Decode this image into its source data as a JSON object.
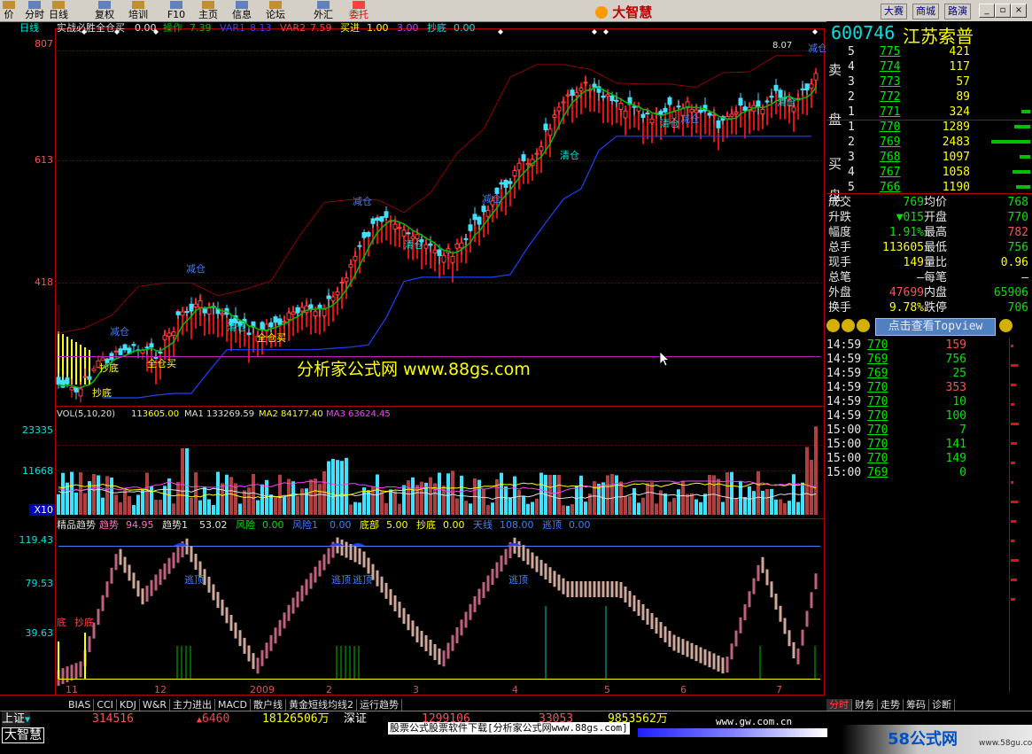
{
  "toolbar": {
    "items": [
      "价",
      "分时",
      "日线",
      "复权",
      "培训",
      "F10",
      "主页",
      "信息",
      "论坛",
      "外汇",
      "委托"
    ],
    "brand": "大智慧",
    "links": [
      "大赛",
      "商城",
      "路演"
    ]
  },
  "chart": {
    "period_label": "日线",
    "main_indicator": {
      "name": "实战必胜全仓买",
      "v": "0.00",
      "items": [
        {
          "t": "操作",
          "c": "#00c000"
        },
        {
          "t": "7.39",
          "c": "#00c000"
        },
        {
          "t": "VAR1",
          "c": "#4040ff"
        },
        {
          "t": "8.13",
          "c": "#4040ff"
        },
        {
          "t": "VAR2",
          "c": "#ff4040"
        },
        {
          "t": "7.59",
          "c": "#ff4040"
        },
        {
          "t": "买进",
          "c": "#ffff00"
        },
        {
          "t": "1.00",
          "c": "#ffff00"
        },
        {
          "t": "3.00",
          "c": "#c040ff"
        },
        {
          "t": "抄底",
          "c": "#00e0e0"
        },
        {
          "t": "0.00",
          "c": "#00e0e0"
        }
      ]
    },
    "y_main": [
      "807",
      "613",
      "418"
    ],
    "price_marker": "8.07",
    "watermark": "分析家公式网 www.88gs.com",
    "signals": [
      "减仓",
      "清仓",
      "减仓",
      "全仓买",
      "抄底",
      "全仓买",
      "减仓",
      "清仓",
      "减仓",
      "清仓",
      "减仓",
      "清仓",
      "清仓",
      "减仓",
      "抄底"
    ],
    "vol_indicator": {
      "label": "VOL(5,10,20)",
      "v": "113605.00",
      "ma1": "MA1 133269.59",
      "ma2": "MA2 84177.40",
      "ma3": "MA3 63624.45"
    },
    "y_vol": [
      "23335",
      "11668",
      "X10"
    ],
    "trend_indicator": {
      "name": "精品趋势",
      "items": [
        {
          "t": "趋势",
          "c": "#ff70c0"
        },
        {
          "t": "94.95",
          "c": "#ff70c0"
        },
        {
          "t": "趋势1",
          "c": "#e0e0e0"
        },
        {
          "t": "53.02",
          "c": "#e0e0e0"
        },
        {
          "t": "风险",
          "c": "#00e000"
        },
        {
          "t": "0.00",
          "c": "#00e000"
        },
        {
          "t": "风险1",
          "c": "#4080ff"
        },
        {
          "t": "0.00",
          "c": "#4080ff"
        },
        {
          "t": "底部",
          "c": "#ffff00"
        },
        {
          "t": "5.00",
          "c": "#ffff00"
        },
        {
          "t": "抄底",
          "c": "#ffff00"
        },
        {
          "t": "0.00",
          "c": "#ffff00"
        },
        {
          "t": "天线",
          "c": "#4080ff"
        },
        {
          "t": "108.00",
          "c": "#4080ff"
        },
        {
          "t": "逃顶",
          "c": "#4080ff"
        },
        {
          "t": "0.00",
          "c": "#4080ff"
        }
      ]
    },
    "y_trend": [
      "119.43",
      "79.53",
      "39.63"
    ],
    "trend_signals": [
      "逃顶",
      "逃顶",
      "逃顶",
      "逃顶"
    ],
    "trend_low_labels": [
      "底",
      "抄底"
    ],
    "x_labels": [
      "11",
      "12",
      "2009",
      "2",
      "3",
      "4",
      "5",
      "6",
      "7"
    ],
    "tabs": [
      "BIAS",
      "CCI",
      "KDJ",
      "W&R",
      "主力进出",
      "MACD",
      "散户线",
      "黄金短线均线2",
      "运行趋势"
    ]
  },
  "quote": {
    "code": "600746",
    "name": "江苏索普",
    "sell_label": [
      "卖",
      "盘"
    ],
    "buy_label": [
      "买",
      "盘"
    ],
    "sell": [
      {
        "lv": "5",
        "p": "775",
        "v": "421"
      },
      {
        "lv": "4",
        "p": "774",
        "v": "117"
      },
      {
        "lv": "3",
        "p": "773",
        "v": "57"
      },
      {
        "lv": "2",
        "p": "772",
        "v": "89"
      },
      {
        "lv": "1",
        "p": "771",
        "v": "324"
      }
    ],
    "buy": [
      {
        "lv": "1",
        "p": "770",
        "v": "1289"
      },
      {
        "lv": "2",
        "p": "769",
        "v": "2483"
      },
      {
        "lv": "3",
        "p": "768",
        "v": "1097"
      },
      {
        "lv": "4",
        "p": "767",
        "v": "1058"
      },
      {
        "lv": "5",
        "p": "766",
        "v": "1190"
      }
    ],
    "stats": [
      {
        "k1": "成交",
        "v1": "769",
        "c1": "green",
        "k2": "均价",
        "v2": "768",
        "c2": "green"
      },
      {
        "k1": "升跌",
        "v1": "▼015",
        "c1": "green",
        "k2": "开盘",
        "v2": "770",
        "c2": "green"
      },
      {
        "k1": "幅度",
        "v1": "1.91%",
        "c1": "green",
        "k2": "最高",
        "v2": "782",
        "c2": "red"
      },
      {
        "k1": "总手",
        "v1": "113605",
        "c1": "yellow",
        "k2": "最低",
        "v2": "756",
        "c2": "green"
      },
      {
        "k1": "现手",
        "v1": "149",
        "c1": "yellow",
        "k2": "量比",
        "v2": "0.96",
        "c2": "yellow"
      },
      {
        "k1": "总笔",
        "v1": "—",
        "c1": "white",
        "k2": "每笔",
        "v2": "—",
        "c2": "white"
      },
      {
        "k1": "外盘",
        "v1": "47699",
        "c1": "red",
        "k2": "内盘",
        "v2": "65906",
        "c2": "green"
      },
      {
        "k1": "换手",
        "v1": "9.78%",
        "c1": "yellow",
        "k2": "跌停",
        "v2": "706",
        "c2": "green"
      }
    ],
    "topview": "点击查看Topview",
    "ticks": [
      {
        "t": "14:59",
        "p": "770",
        "v": "159",
        "vc": "red"
      },
      {
        "t": "14:59",
        "p": "769",
        "v": "756",
        "vc": "green"
      },
      {
        "t": "14:59",
        "p": "769",
        "v": "25",
        "vc": "green"
      },
      {
        "t": "14:59",
        "p": "770",
        "v": "353",
        "vc": "red"
      },
      {
        "t": "14:59",
        "p": "770",
        "v": "10",
        "vc": "green"
      },
      {
        "t": "14:59",
        "p": "770",
        "v": "100",
        "vc": "green"
      },
      {
        "t": "15:00",
        "p": "770",
        "v": "7",
        "vc": "green"
      },
      {
        "t": "15:00",
        "p": "770",
        "v": "141",
        "vc": "green"
      },
      {
        "t": "15:00",
        "p": "770",
        "v": "149",
        "vc": "green"
      },
      {
        "t": "15:00",
        "p": "769",
        "v": "0",
        "vc": "green"
      }
    ],
    "bottom_tabs": [
      "分时",
      "财务",
      "走势",
      "筹码",
      "诊断"
    ]
  },
  "status": {
    "r1": {
      "idx": "上证",
      "v1": "314516",
      "v2": "6460",
      "v3": "18126506万",
      "idx2": "深证",
      "v4": "1299106",
      "v5": "33053",
      "v6": "9853562万"
    },
    "r2": {
      "brand": "大智慧",
      "ad": "股票公式股票软件下载[分析家公式网www.88gs.com]",
      "url": "www.gw.com.cn",
      "logo": "58公式网",
      "logo_url": "www.58gu.com"
    }
  },
  "colors": {
    "up": "#ff4040",
    "down": "#00e0e0",
    "bg": "#000000"
  }
}
